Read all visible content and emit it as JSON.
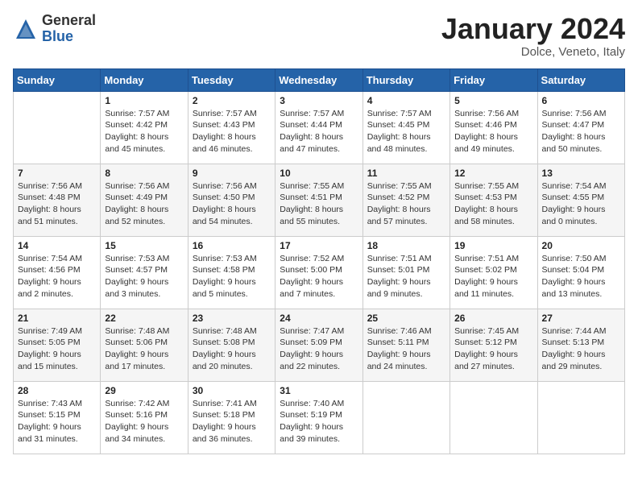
{
  "header": {
    "logo_general": "General",
    "logo_blue": "Blue",
    "month_title": "January 2024",
    "location": "Dolce, Veneto, Italy"
  },
  "days_of_week": [
    "Sunday",
    "Monday",
    "Tuesday",
    "Wednesday",
    "Thursday",
    "Friday",
    "Saturday"
  ],
  "weeks": [
    [
      {
        "day": "",
        "info": ""
      },
      {
        "day": "1",
        "info": "Sunrise: 7:57 AM\nSunset: 4:42 PM\nDaylight: 8 hours\nand 45 minutes."
      },
      {
        "day": "2",
        "info": "Sunrise: 7:57 AM\nSunset: 4:43 PM\nDaylight: 8 hours\nand 46 minutes."
      },
      {
        "day": "3",
        "info": "Sunrise: 7:57 AM\nSunset: 4:44 PM\nDaylight: 8 hours\nand 47 minutes."
      },
      {
        "day": "4",
        "info": "Sunrise: 7:57 AM\nSunset: 4:45 PM\nDaylight: 8 hours\nand 48 minutes."
      },
      {
        "day": "5",
        "info": "Sunrise: 7:56 AM\nSunset: 4:46 PM\nDaylight: 8 hours\nand 49 minutes."
      },
      {
        "day": "6",
        "info": "Sunrise: 7:56 AM\nSunset: 4:47 PM\nDaylight: 8 hours\nand 50 minutes."
      }
    ],
    [
      {
        "day": "7",
        "info": "Sunrise: 7:56 AM\nSunset: 4:48 PM\nDaylight: 8 hours\nand 51 minutes."
      },
      {
        "day": "8",
        "info": "Sunrise: 7:56 AM\nSunset: 4:49 PM\nDaylight: 8 hours\nand 52 minutes."
      },
      {
        "day": "9",
        "info": "Sunrise: 7:56 AM\nSunset: 4:50 PM\nDaylight: 8 hours\nand 54 minutes."
      },
      {
        "day": "10",
        "info": "Sunrise: 7:55 AM\nSunset: 4:51 PM\nDaylight: 8 hours\nand 55 minutes."
      },
      {
        "day": "11",
        "info": "Sunrise: 7:55 AM\nSunset: 4:52 PM\nDaylight: 8 hours\nand 57 minutes."
      },
      {
        "day": "12",
        "info": "Sunrise: 7:55 AM\nSunset: 4:53 PM\nDaylight: 8 hours\nand 58 minutes."
      },
      {
        "day": "13",
        "info": "Sunrise: 7:54 AM\nSunset: 4:55 PM\nDaylight: 9 hours\nand 0 minutes."
      }
    ],
    [
      {
        "day": "14",
        "info": "Sunrise: 7:54 AM\nSunset: 4:56 PM\nDaylight: 9 hours\nand 2 minutes."
      },
      {
        "day": "15",
        "info": "Sunrise: 7:53 AM\nSunset: 4:57 PM\nDaylight: 9 hours\nand 3 minutes."
      },
      {
        "day": "16",
        "info": "Sunrise: 7:53 AM\nSunset: 4:58 PM\nDaylight: 9 hours\nand 5 minutes."
      },
      {
        "day": "17",
        "info": "Sunrise: 7:52 AM\nSunset: 5:00 PM\nDaylight: 9 hours\nand 7 minutes."
      },
      {
        "day": "18",
        "info": "Sunrise: 7:51 AM\nSunset: 5:01 PM\nDaylight: 9 hours\nand 9 minutes."
      },
      {
        "day": "19",
        "info": "Sunrise: 7:51 AM\nSunset: 5:02 PM\nDaylight: 9 hours\nand 11 minutes."
      },
      {
        "day": "20",
        "info": "Sunrise: 7:50 AM\nSunset: 5:04 PM\nDaylight: 9 hours\nand 13 minutes."
      }
    ],
    [
      {
        "day": "21",
        "info": "Sunrise: 7:49 AM\nSunset: 5:05 PM\nDaylight: 9 hours\nand 15 minutes."
      },
      {
        "day": "22",
        "info": "Sunrise: 7:48 AM\nSunset: 5:06 PM\nDaylight: 9 hours\nand 17 minutes."
      },
      {
        "day": "23",
        "info": "Sunrise: 7:48 AM\nSunset: 5:08 PM\nDaylight: 9 hours\nand 20 minutes."
      },
      {
        "day": "24",
        "info": "Sunrise: 7:47 AM\nSunset: 5:09 PM\nDaylight: 9 hours\nand 22 minutes."
      },
      {
        "day": "25",
        "info": "Sunrise: 7:46 AM\nSunset: 5:11 PM\nDaylight: 9 hours\nand 24 minutes."
      },
      {
        "day": "26",
        "info": "Sunrise: 7:45 AM\nSunset: 5:12 PM\nDaylight: 9 hours\nand 27 minutes."
      },
      {
        "day": "27",
        "info": "Sunrise: 7:44 AM\nSunset: 5:13 PM\nDaylight: 9 hours\nand 29 minutes."
      }
    ],
    [
      {
        "day": "28",
        "info": "Sunrise: 7:43 AM\nSunset: 5:15 PM\nDaylight: 9 hours\nand 31 minutes."
      },
      {
        "day": "29",
        "info": "Sunrise: 7:42 AM\nSunset: 5:16 PM\nDaylight: 9 hours\nand 34 minutes."
      },
      {
        "day": "30",
        "info": "Sunrise: 7:41 AM\nSunset: 5:18 PM\nDaylight: 9 hours\nand 36 minutes."
      },
      {
        "day": "31",
        "info": "Sunrise: 7:40 AM\nSunset: 5:19 PM\nDaylight: 9 hours\nand 39 minutes."
      },
      {
        "day": "",
        "info": ""
      },
      {
        "day": "",
        "info": ""
      },
      {
        "day": "",
        "info": ""
      }
    ]
  ]
}
